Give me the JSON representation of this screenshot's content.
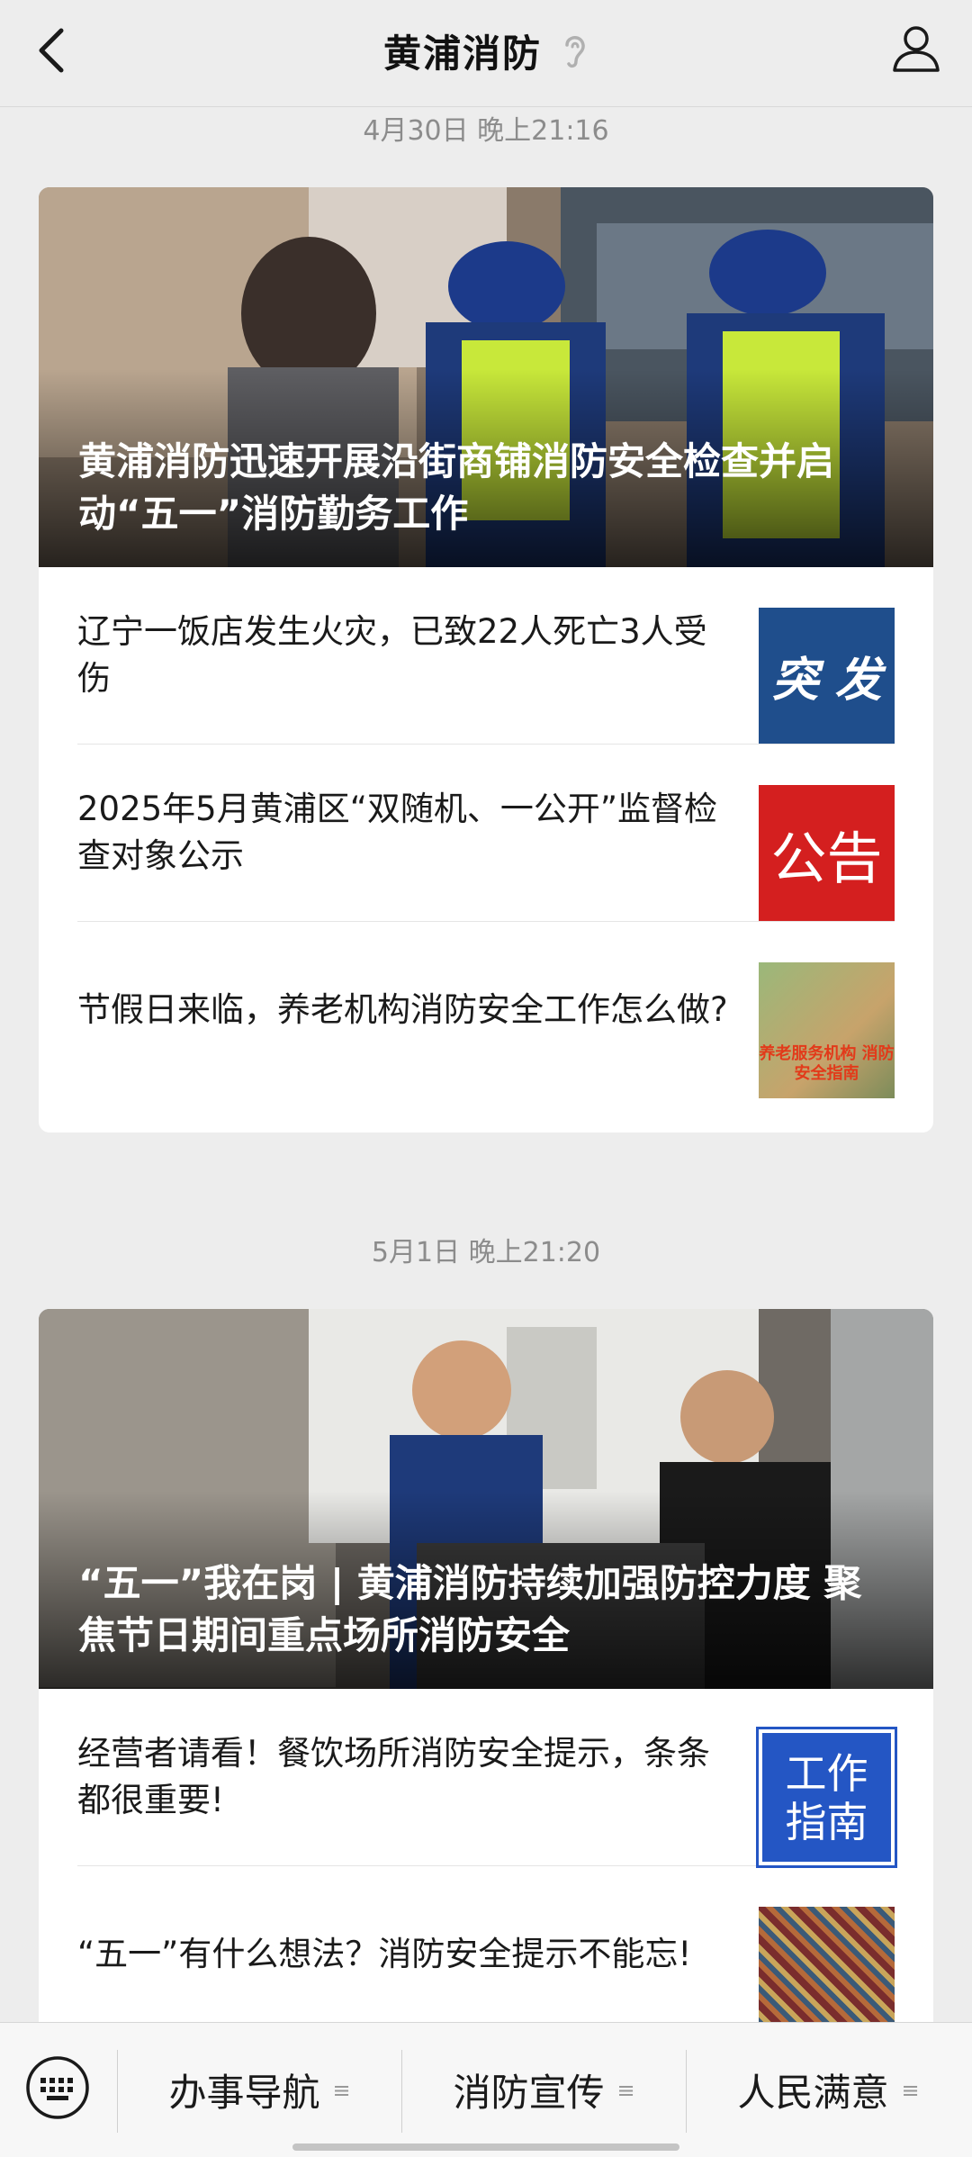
{
  "header": {
    "title": "黄浦消防"
  },
  "groups": [
    {
      "timestamp": "4月30日 晚上21:16",
      "hero_title": "黄浦消防迅速开展沿街商铺消防安全检查并启动“五一”消防勤务工作",
      "items": [
        {
          "text": "辽宁一饭店发生火灾，已致22人死亡3人受伤",
          "thumb": "突 发"
        },
        {
          "text": "2025年5月黄浦区“双随机、一公开”监督检查对象公示",
          "thumb": "公告"
        },
        {
          "text": "节假日来临，养老机构消防安全工作怎么做?",
          "thumb": "养老服务机构 消防安全指南"
        }
      ]
    },
    {
      "timestamp": "5月1日 晚上21:20",
      "hero_title": "“五一”我在岗 | 黄浦消防持续加强防控力度 聚焦节日期间重点场所消防安全",
      "items": [
        {
          "text": "经营者请看！餐饮场所消防安全提示，条条都很重要!",
          "thumb": "工作 指南"
        },
        {
          "text": "“五一”有什么想法？消防安全提示不能忘!",
          "thumb": ""
        }
      ]
    }
  ],
  "bottom_menu": [
    {
      "label": "办事导航"
    },
    {
      "label": "消防宣传"
    },
    {
      "label": "人民满意"
    }
  ]
}
